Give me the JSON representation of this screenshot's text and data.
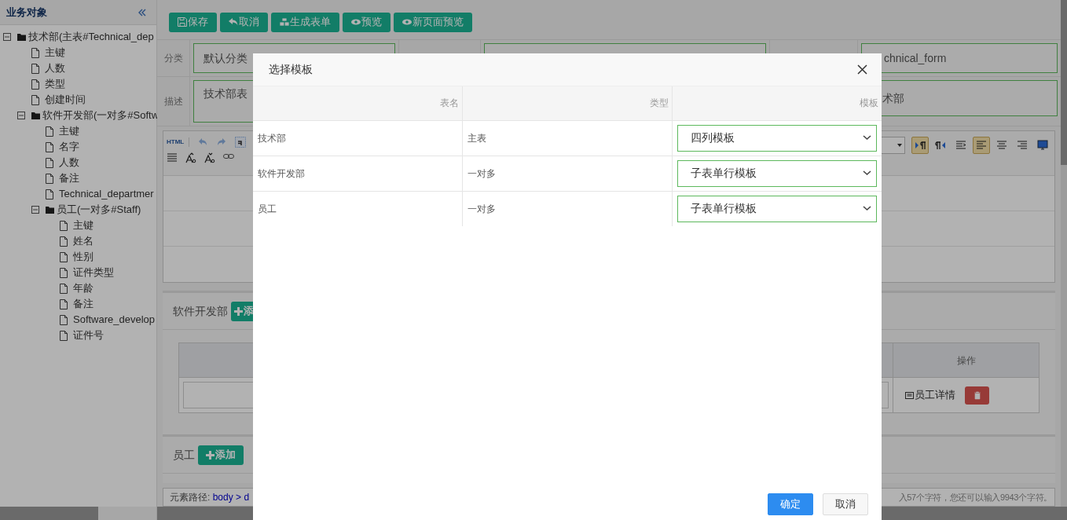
{
  "sidebar": {
    "title": "业务对象",
    "tree": [
      {
        "label": "技术部(主表#Technical_dep",
        "kind": "folder",
        "expanded": true,
        "children": [
          {
            "label": "主键",
            "kind": "file"
          },
          {
            "label": "人数",
            "kind": "file"
          },
          {
            "label": "类型",
            "kind": "file"
          },
          {
            "label": "创建时间",
            "kind": "file"
          },
          {
            "label": "软件开发部(一对多#Softw",
            "kind": "folder",
            "expanded": true,
            "children": [
              {
                "label": "主键",
                "kind": "file"
              },
              {
                "label": "名字",
                "kind": "file"
              },
              {
                "label": "人数",
                "kind": "file"
              },
              {
                "label": "备注",
                "kind": "file"
              },
              {
                "label": "Technical_departmer",
                "kind": "file"
              },
              {
                "label": "员工(一对多#Staff)",
                "kind": "folder",
                "expanded": true,
                "children": [
                  {
                    "label": "主键",
                    "kind": "file"
                  },
                  {
                    "label": "姓名",
                    "kind": "file"
                  },
                  {
                    "label": "性别",
                    "kind": "file"
                  },
                  {
                    "label": "证件类型",
                    "kind": "file"
                  },
                  {
                    "label": "年龄",
                    "kind": "file"
                  },
                  {
                    "label": "备注",
                    "kind": "file"
                  },
                  {
                    "label": "Software_develop",
                    "kind": "file"
                  },
                  {
                    "label": "证件号",
                    "kind": "file"
                  }
                ]
              }
            ]
          }
        ]
      }
    ]
  },
  "toolbar": {
    "buttons": [
      {
        "label": "保存",
        "kind": "save"
      },
      {
        "label": "取消",
        "kind": "undo"
      },
      {
        "label": "生成表单",
        "kind": "cubes"
      },
      {
        "label": "预览",
        "kind": "eye"
      },
      {
        "label": "新页面预览",
        "kind": "eye"
      }
    ]
  },
  "form": {
    "rows": [
      {
        "label": "分类",
        "value": "默认分类",
        "right_value": "chnical_form"
      },
      {
        "label": "描述",
        "value": "技术部表",
        "right_value": "术部"
      }
    ]
  },
  "editor": {
    "mode_label": "HTML",
    "left_tools": [
      {
        "kind": "undo"
      },
      {
        "kind": "redo"
      },
      {
        "kind": "boxed-a"
      }
    ],
    "left_tools_2": [
      {
        "kind": "lines"
      },
      {
        "kind": "font-up"
      },
      {
        "kind": "font-down"
      },
      {
        "kind": "link"
      }
    ],
    "right_tools": [
      {
        "kind": "ltr",
        "selected": true
      },
      {
        "kind": "rtl",
        "selected": false
      },
      {
        "kind": "indent",
        "selected": false
      },
      {
        "kind": "align-left",
        "selected": true
      },
      {
        "kind": "align-center",
        "selected": false
      },
      {
        "kind": "align-right",
        "selected": false
      },
      {
        "kind": "monitor",
        "selected": false
      }
    ],
    "path_label": "元素路径:",
    "path": "body > d",
    "count": "入57个字符，您还可以输入9943个字符。"
  },
  "sections": [
    {
      "title": "软件开发部",
      "add_button": "添",
      "table": {
        "columns": [
          "操作"
        ],
        "rows": [
          {
            "link": "员工详情"
          }
        ]
      }
    },
    {
      "title": "员工",
      "add_button": "添加"
    }
  ],
  "modal": {
    "title": "选择模板",
    "columns": [
      "表名",
      "类型",
      "模板"
    ],
    "rows": [
      {
        "name": "技术部",
        "type": "主表",
        "template": "四列模板"
      },
      {
        "name": "软件开发部",
        "type": "一对多",
        "template": "子表单行模板"
      },
      {
        "name": "员工",
        "type": "一对多",
        "template": "子表单行模板"
      }
    ],
    "buttons": [
      {
        "label": "确定",
        "kind": "primary"
      },
      {
        "label": "取消",
        "kind": "default"
      }
    ]
  }
}
